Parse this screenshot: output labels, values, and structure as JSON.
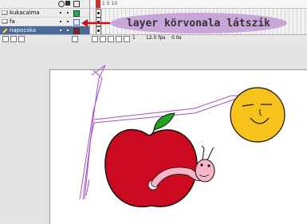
{
  "layers": [
    {
      "name": "kukacalma",
      "outline_color": "#1db33a",
      "selected": false
    },
    {
      "name": "fa",
      "outline_color": "#3a6fd8",
      "selected": false
    },
    {
      "name": "napocska",
      "outline_color": "#8a2020",
      "selected": true
    }
  ],
  "timeline": {
    "frame_numbers": "1   5   10",
    "fps": "12.0 fps",
    "time": "0.0s",
    "current_frame": "1"
  },
  "annotation": {
    "text": "layer körvonala látszik",
    "color": "#c9a6d9"
  },
  "colors": {
    "apple": "#cc0a1f",
    "leaf": "#22a01e",
    "sun": "#f7c21a",
    "worm": "#f6b6c8",
    "tree_outline": "#a250c8",
    "playhead": "#d03030"
  },
  "icons": [
    "eye-icon",
    "lock-icon",
    "outline-icon",
    "layer-icon",
    "arrow-icon"
  ]
}
